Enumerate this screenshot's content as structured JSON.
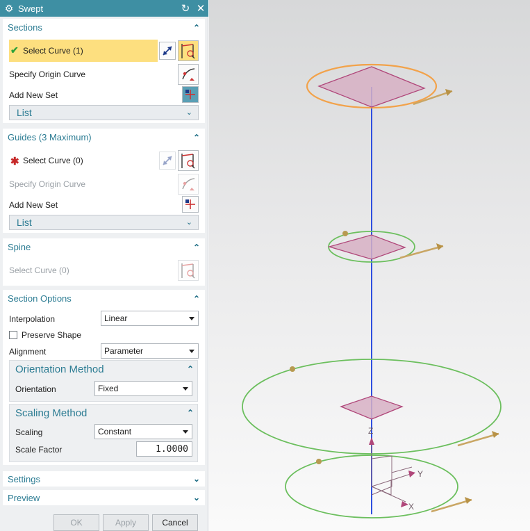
{
  "window": {
    "title": "Swept"
  },
  "sections": {
    "header": "Sections",
    "select_curve": "Select Curve (1)",
    "specify_origin": "Specify Origin Curve",
    "add_new_set": "Add New Set",
    "list_label": "List"
  },
  "guides": {
    "header": "Guides (3 Maximum)",
    "select_curve": "Select Curve (0)",
    "specify_origin": "Specify Origin Curve",
    "add_new_set": "Add New Set",
    "list_label": "List"
  },
  "spine": {
    "header": "Spine",
    "select_curve": "Select Curve (0)"
  },
  "section_options": {
    "header": "Section Options",
    "interpolation_label": "Interpolation",
    "interpolation_value": "Linear",
    "preserve_shape_label": "Preserve Shape",
    "preserve_shape_checked": false,
    "alignment_label": "Alignment",
    "alignment_value": "Parameter",
    "orientation_method": {
      "header": "Orientation Method",
      "orientation_label": "Orientation",
      "orientation_value": "Fixed"
    },
    "scaling_method": {
      "header": "Scaling Method",
      "scaling_label": "Scaling",
      "scaling_value": "Constant",
      "scale_factor_label": "Scale Factor",
      "scale_factor_value": "1.0000"
    }
  },
  "settings": {
    "header": "Settings"
  },
  "preview": {
    "header": "Preview"
  },
  "buttons": {
    "ok": "OK",
    "apply": "Apply",
    "cancel": "Cancel"
  },
  "viewport": {
    "axes": {
      "x": "X",
      "y": "Y",
      "z": "Z"
    },
    "colors": {
      "spine": "#2f4fe0",
      "section_highlight": "#f2a24a",
      "guide_circle": "#6cbf5e",
      "section_fill": "#d7b0c4",
      "section_stroke": "#b0477a",
      "arrow": "#c9a664"
    }
  },
  "colors": {
    "title_bar": "#3e8fa3",
    "accent_text": "#2c7c93",
    "selection_highlight": "#fddf7f",
    "check_mark": "#2fa23a",
    "required_star": "#c62828"
  }
}
